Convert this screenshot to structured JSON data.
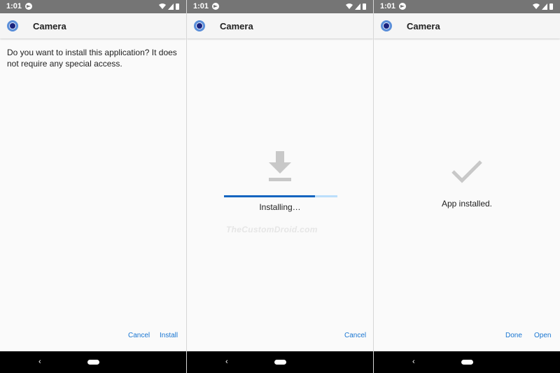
{
  "status_bar": {
    "time": "1:01"
  },
  "app": {
    "title": "Camera"
  },
  "panel1": {
    "prompt": "Do you want to install this application? It does not require any special access.",
    "cancel_label": "Cancel",
    "install_label": "Install"
  },
  "panel2": {
    "status": "Installing…",
    "cancel_label": "Cancel",
    "progress_fraction": 0.8
  },
  "panel3": {
    "status": "App installed.",
    "done_label": "Done",
    "open_label": "Open"
  },
  "watermark": "TheCustomDroid.com",
  "icons": {
    "app": "camera-app-icon",
    "download": "download-icon",
    "success": "checkmark-icon",
    "back": "back-icon",
    "home": "home-pill-icon"
  },
  "colors": {
    "accent": "#1976d2",
    "progress_fill": "#1565c0",
    "progress_track": "#bbdefb",
    "status_bar": "#757575",
    "nav_bar": "#000000"
  }
}
